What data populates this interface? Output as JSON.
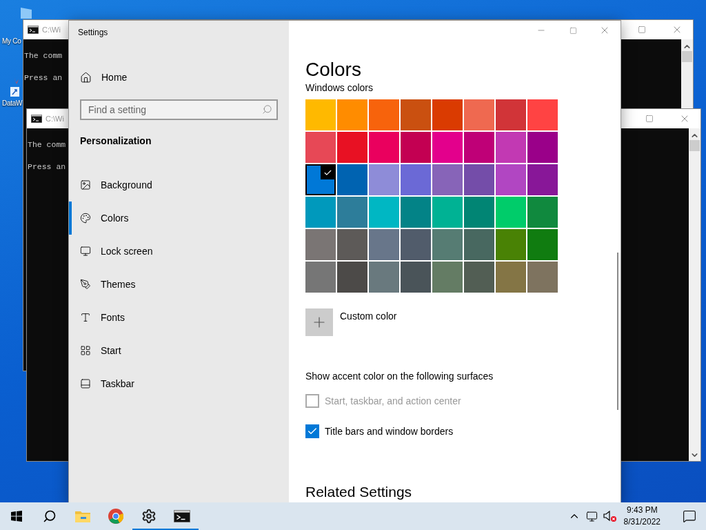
{
  "desktop": {
    "icons": [
      {
        "label": "My Co"
      },
      {
        "label": "DataW"
      }
    ]
  },
  "console_windows": [
    {
      "title": "C:\\Wi",
      "lines": [
        "The comm",
        "Press an"
      ]
    },
    {
      "title": "C:\\Wi",
      "lines": [
        "The comm",
        "Press an"
      ]
    }
  ],
  "settings": {
    "title": "Settings",
    "home": "Home",
    "search": {
      "placeholder": "Find a setting"
    },
    "section": "Personalization",
    "nav": [
      {
        "label": "Background",
        "selected": false
      },
      {
        "label": "Colors",
        "selected": true
      },
      {
        "label": "Lock screen",
        "selected": false
      },
      {
        "label": "Themes",
        "selected": false
      },
      {
        "label": "Fonts",
        "selected": false
      },
      {
        "label": "Start",
        "selected": false
      },
      {
        "label": "Taskbar",
        "selected": false
      }
    ]
  },
  "page": {
    "title": "Colors",
    "palette_label": "Windows colors",
    "swatches": [
      {
        "color": "#ffb900",
        "selected": false
      },
      {
        "color": "#ff8c00",
        "selected": false
      },
      {
        "color": "#f7630c",
        "selected": false
      },
      {
        "color": "#ca5010",
        "selected": false
      },
      {
        "color": "#da3b01",
        "selected": false
      },
      {
        "color": "#ef6950",
        "selected": false
      },
      {
        "color": "#d13438",
        "selected": false
      },
      {
        "color": "#ff4343",
        "selected": false
      },
      {
        "color": "#e74856",
        "selected": false
      },
      {
        "color": "#e81123",
        "selected": false
      },
      {
        "color": "#ea005e",
        "selected": false
      },
      {
        "color": "#c30052",
        "selected": false
      },
      {
        "color": "#e3008c",
        "selected": false
      },
      {
        "color": "#bf0077",
        "selected": false
      },
      {
        "color": "#c239b3",
        "selected": false
      },
      {
        "color": "#9a0089",
        "selected": false
      },
      {
        "color": "#0078d7",
        "selected": true
      },
      {
        "color": "#0063b1",
        "selected": false
      },
      {
        "color": "#8e8cd8",
        "selected": false
      },
      {
        "color": "#6b69d6",
        "selected": false
      },
      {
        "color": "#8764b8",
        "selected": false
      },
      {
        "color": "#744da9",
        "selected": false
      },
      {
        "color": "#b146c2",
        "selected": false
      },
      {
        "color": "#881798",
        "selected": false
      },
      {
        "color": "#0099bc",
        "selected": false
      },
      {
        "color": "#2d7d9a",
        "selected": false
      },
      {
        "color": "#00b7c3",
        "selected": false
      },
      {
        "color": "#038387",
        "selected": false
      },
      {
        "color": "#00b294",
        "selected": false
      },
      {
        "color": "#018574",
        "selected": false
      },
      {
        "color": "#00cc6a",
        "selected": false
      },
      {
        "color": "#10893e",
        "selected": false
      },
      {
        "color": "#7a7574",
        "selected": false
      },
      {
        "color": "#5d5a58",
        "selected": false
      },
      {
        "color": "#68768a",
        "selected": false
      },
      {
        "color": "#515c6b",
        "selected": false
      },
      {
        "color": "#567c73",
        "selected": false
      },
      {
        "color": "#486860",
        "selected": false
      },
      {
        "color": "#498205",
        "selected": false
      },
      {
        "color": "#107c10",
        "selected": false
      },
      {
        "color": "#767676",
        "selected": false
      },
      {
        "color": "#4c4a48",
        "selected": false
      },
      {
        "color": "#69797e",
        "selected": false
      },
      {
        "color": "#4a5459",
        "selected": false
      },
      {
        "color": "#647c64",
        "selected": false
      },
      {
        "color": "#525e54",
        "selected": false
      },
      {
        "color": "#847545",
        "selected": false
      },
      {
        "color": "#7e735f",
        "selected": false
      }
    ],
    "custom_color": "Custom color",
    "accent_heading": "Show accent color on the following surfaces",
    "options": [
      {
        "label": "Start, taskbar, and action center",
        "checked": false,
        "disabled": true
      },
      {
        "label": "Title bars and window borders",
        "checked": true,
        "disabled": false
      }
    ],
    "related": "Related Settings"
  },
  "taskbar": {
    "apps": [
      {
        "running": false
      },
      {
        "running": false
      },
      {
        "running": false
      },
      {
        "running": false
      },
      {
        "running": true
      },
      {
        "running": true
      }
    ],
    "clock": {
      "time": "9:43 PM",
      "date": "8/31/2022"
    }
  }
}
